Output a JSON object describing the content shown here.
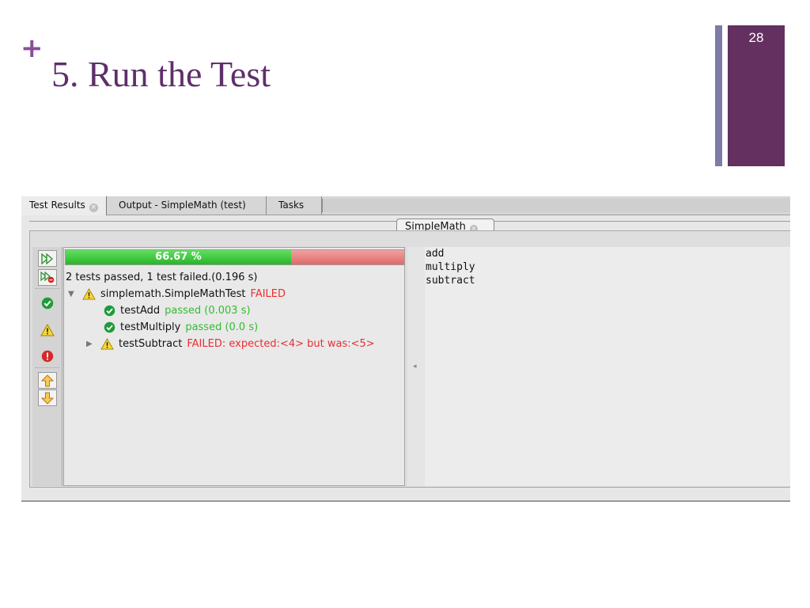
{
  "slide": {
    "plus": "+",
    "title": "5. Run the Test",
    "number": "28"
  },
  "ide": {
    "tabs": [
      {
        "label": "Test Results",
        "closable": true
      },
      {
        "label": "Output - SimpleMath (test)",
        "closable": false
      },
      {
        "label": "Tasks",
        "closable": false
      }
    ],
    "subtab": {
      "label": "SimpleMath"
    },
    "progress": {
      "label": "66.67 %",
      "fraction": 0.6667
    },
    "summary": "2 tests passed, 1 test failed.(0.196 s)",
    "tree": {
      "suite": {
        "name": "simplemath.SimpleMathTest",
        "status": "FAILED"
      },
      "tests": [
        {
          "name": "testAdd",
          "result": "passed  (0.003 s)",
          "state": "ok"
        },
        {
          "name": "testMultiply",
          "result": "passed  (0.0 s)",
          "state": "ok"
        },
        {
          "name": "testSubtract",
          "result": "FAILED: expected:<4> but was:<5>",
          "state": "fail"
        }
      ]
    },
    "output_lines": [
      "add",
      "multiply",
      "subtract"
    ],
    "colors": {
      "passed": "#33bb33",
      "failed": "#e83030",
      "progress_green": "#29b429",
      "progress_red": "#df6969",
      "slide_accent": "#63305f"
    },
    "icons": {
      "rerun": "double-play-icon",
      "rerun_failed": "double-play-error-icon",
      "show_passed": "check-circle-icon",
      "show_warning": "warning-triangle-icon",
      "show_errors": "error-circle-icon",
      "previous": "arrow-up-icon",
      "next": "arrow-down-icon"
    }
  }
}
